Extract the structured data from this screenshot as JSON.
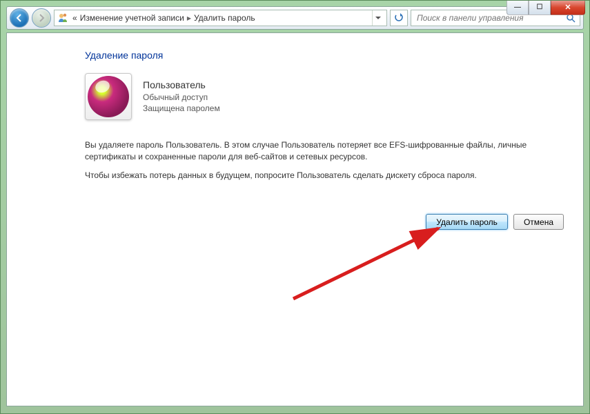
{
  "breadcrumb": {
    "prefix": "«",
    "item1": "Изменение учетной записи",
    "item2": "Удалить пароль"
  },
  "search": {
    "placeholder": "Поиск в панели управления"
  },
  "page": {
    "title": "Удаление пароля",
    "user_name": "Пользователь",
    "user_access": "Обычный доступ",
    "user_protected": "Защищена паролем",
    "para1": "Вы удаляете пароль Пользователь. В этом случае Пользователь потеряет все EFS-шифрованные файлы, личные сертификаты и сохраненные пароли для веб-сайтов и сетевых ресурсов.",
    "para2": "Чтобы избежать потерь данных в будущем, попросите Пользователь сделать дискету сброса пароля."
  },
  "buttons": {
    "remove": "Удалить пароль",
    "cancel": "Отмена"
  }
}
